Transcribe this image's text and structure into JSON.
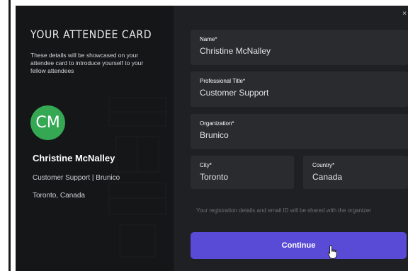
{
  "card": {
    "title": "YOUR ATTENDEE CARD",
    "description": "These details will be showcased on your attendee card to introduce yourself to your fellow attendees",
    "avatar_initials": "CM",
    "avatar_color": "#34a853",
    "name": "Christine McNalley",
    "role": "Customer Support | Brunico",
    "location": "Toronto, Canada"
  },
  "form": {
    "close_label": "×",
    "name": {
      "label": "Name*",
      "value": "Christine McNalley"
    },
    "professional_title": {
      "label": "Professional Title*",
      "value": "Customer Support"
    },
    "organization": {
      "label": "Organization*",
      "value": "Brunico"
    },
    "city": {
      "label": "City*",
      "value": "Toronto"
    },
    "country": {
      "label": "Country*",
      "value": "Canada"
    },
    "notice": "Your registration details and email ID will be shared with the organizer",
    "continue_label": "Continue"
  },
  "colors": {
    "accent": "#5a4bd6",
    "panel_dark": "#151618",
    "modal_bg": "#1f2023",
    "field_bg": "#2a2b2f"
  }
}
